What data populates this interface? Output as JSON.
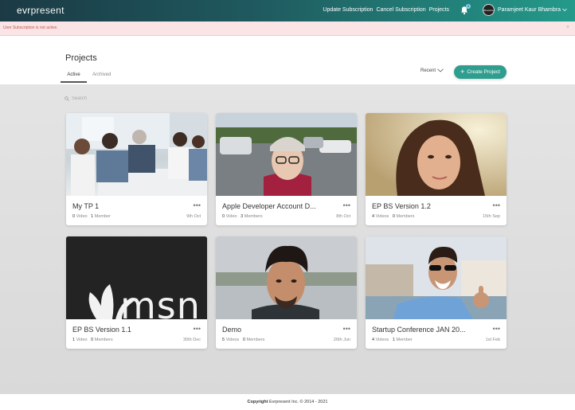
{
  "app": {
    "logo_bold": "evr",
    "logo_thin": "present"
  },
  "nav": {
    "links": [
      "Update Subscription",
      "Cancel Subscription",
      "Projects"
    ],
    "notification_count": "0",
    "avatar_text": "Bhambra",
    "user_name": "Paramjeet Kaur Bhambra"
  },
  "alert": {
    "message": "User Subscription is not active.",
    "close": "×"
  },
  "header": {
    "title": "Projects",
    "tabs": [
      "Active",
      "Archived"
    ],
    "sort_label": "Recent",
    "create_label": "Create Project"
  },
  "search": {
    "placeholder": "Search"
  },
  "projects": [
    {
      "title": "My TP 1",
      "videos_count": "0",
      "videos_label": "Video",
      "members_count": "1",
      "members_label": "Member",
      "date": "9th Oct",
      "thumb": "office-meeting"
    },
    {
      "title": "Apple Developer Account D...",
      "videos_count": "0",
      "videos_label": "Video",
      "members_count": "3",
      "members_label": "Members",
      "date": "8th Oct",
      "thumb": "selfie-parking-lot"
    },
    {
      "title": "EP BS Version 1.2",
      "videos_count": "4",
      "videos_label": "Videos",
      "members_count": "0",
      "members_label": "Members",
      "date": "15th Sep",
      "thumb": "woman-portrait"
    },
    {
      "title": "EP BS Version 1.1",
      "videos_count": "1",
      "videos_label": "Video",
      "members_count": "0",
      "members_label": "Members",
      "date": "30th Dec",
      "thumb": "msn-logo",
      "thumb_text": "msn"
    },
    {
      "title": "Demo",
      "videos_count": "5",
      "videos_label": "Videos",
      "members_count": "0",
      "members_label": "Members",
      "date": "26th Jun",
      "thumb": "man-selfie-lake"
    },
    {
      "title": "Startup Conference JAN 20...",
      "videos_count": "4",
      "videos_label": "Videos",
      "members_count": "1",
      "members_label": "Member",
      "date": "1st Feb",
      "thumb": "man-sunglasses-thumbsup"
    }
  ],
  "more_label": "•••",
  "footer": {
    "copyright_label": "Copyright",
    "text": "Evrpresent Inc. © 2014 - 2021"
  },
  "colors": {
    "accent": "#2f9e8f",
    "nav_dark": "#1b3a45",
    "alert_bg": "#fbe4e6",
    "alert_text": "#c0584f"
  }
}
